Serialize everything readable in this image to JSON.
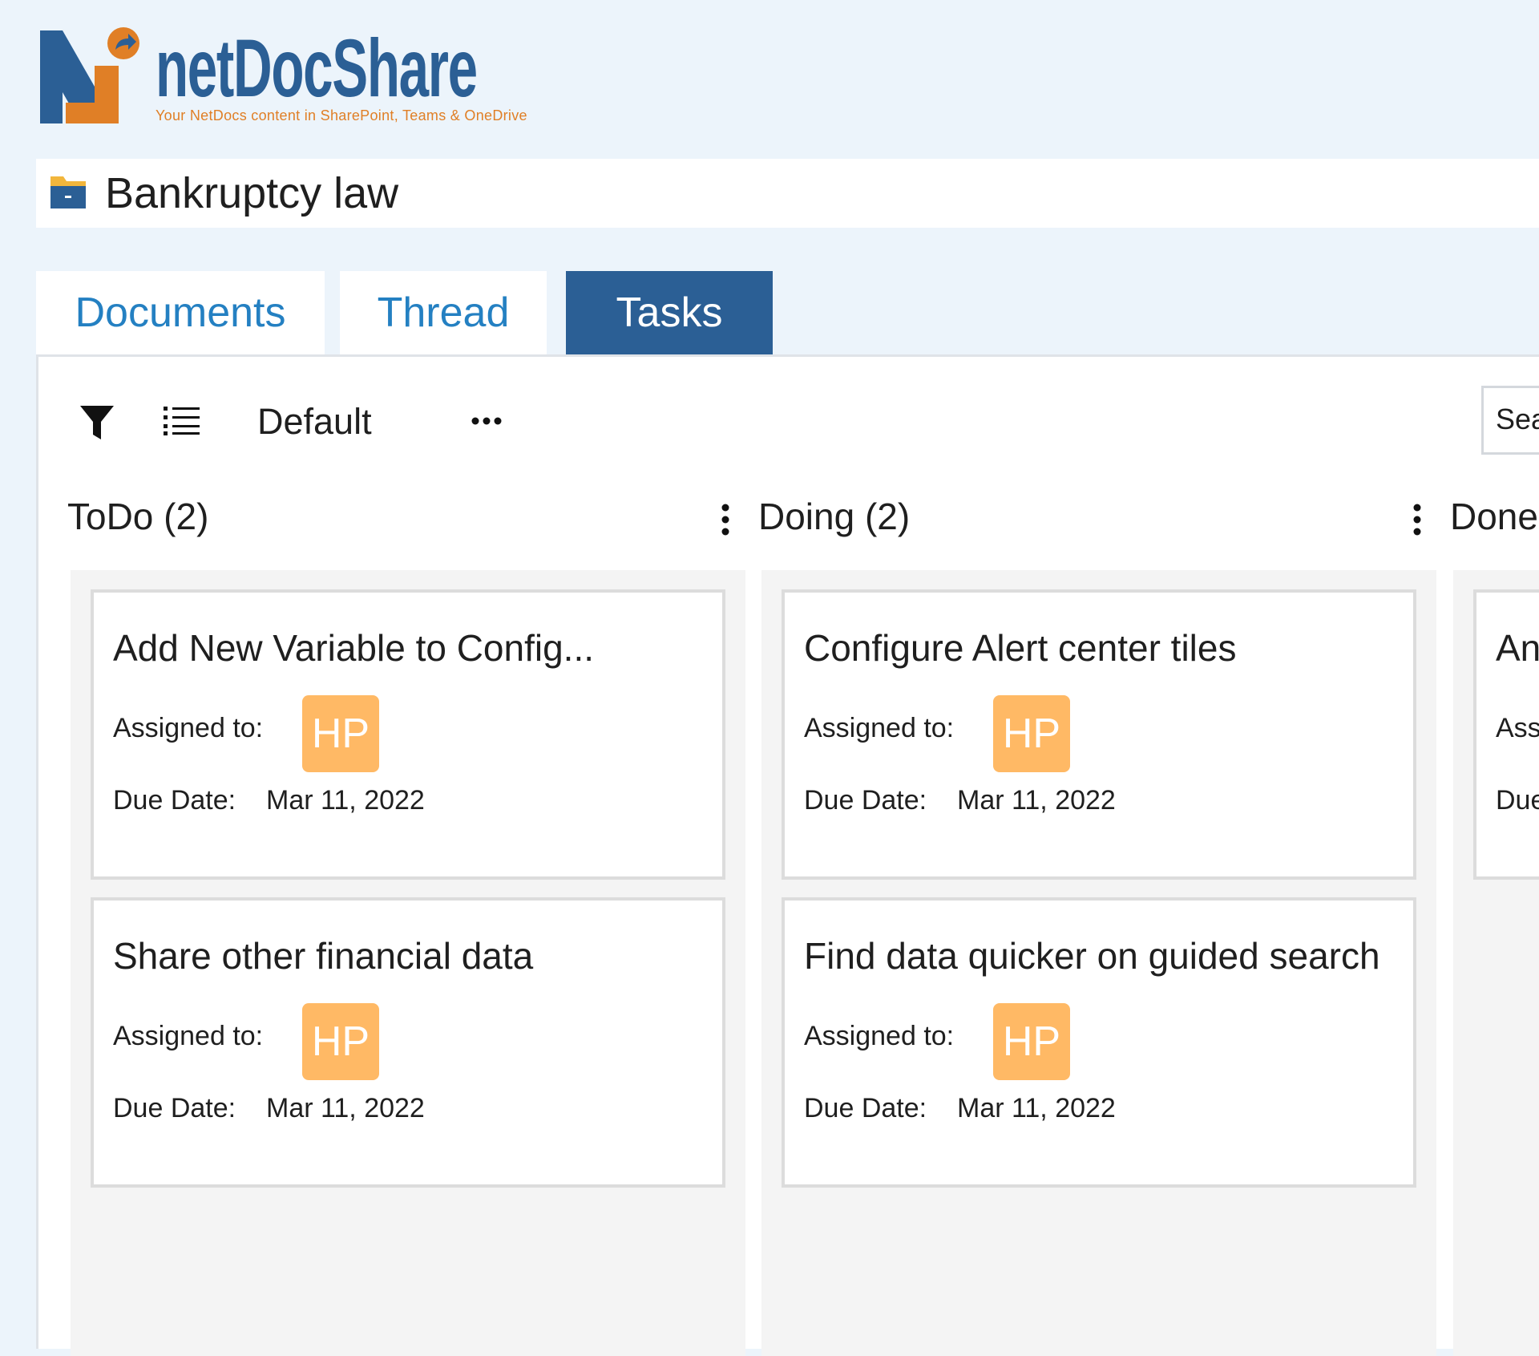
{
  "brand": {
    "name": "netDocShare",
    "tagline": "Your NetDocs content in SharePoint, Teams & OneDrive"
  },
  "page": {
    "title": "Bankruptcy law"
  },
  "tabs": [
    {
      "label": "Documents",
      "active": false
    },
    {
      "label": "Thread",
      "active": false
    },
    {
      "label": "Tasks",
      "active": true
    }
  ],
  "toolbar": {
    "view_name": "Default",
    "search_placeholder": "Search"
  },
  "columns": [
    {
      "title": "ToDo (2)",
      "cards": [
        {
          "title": "Add New Variable to Config...",
          "assigned_label": "Assigned to:",
          "assignee_initials": "HP",
          "due_label": "Due Date:",
          "due_date": "Mar 11, 2022"
        },
        {
          "title": "Share other financial data",
          "assigned_label": "Assigned to:",
          "assignee_initials": "HP",
          "due_label": "Due Date:",
          "due_date": "Mar 11, 2022"
        }
      ]
    },
    {
      "title": "Doing (2)",
      "cards": [
        {
          "title": "Configure Alert center tiles",
          "assigned_label": "Assigned to:",
          "assignee_initials": "HP",
          "due_label": "Due Date:",
          "due_date": "Mar 11, 2022"
        },
        {
          "title": "Find data quicker on guided search",
          "assigned_label": "Assigned to:",
          "assignee_initials": "HP",
          "due_label": "Due Date:",
          "due_date": "Mar 11, 2022"
        }
      ]
    },
    {
      "title": "Done",
      "cards": [
        {
          "title": "An",
          "assigned_label": "Ass",
          "due_label": "Due"
        }
      ]
    }
  ],
  "colors": {
    "brand_blue": "#2b5f95",
    "brand_orange": "#e07f26",
    "tab_text": "#2480c2",
    "avatar_bg": "#ffb965",
    "page_bg": "#ecf4fb"
  },
  "icons": [
    "netdocshare-logo",
    "folder-icon",
    "filter-icon",
    "list-icon",
    "more-horizontal-icon",
    "more-vertical-icon"
  ]
}
